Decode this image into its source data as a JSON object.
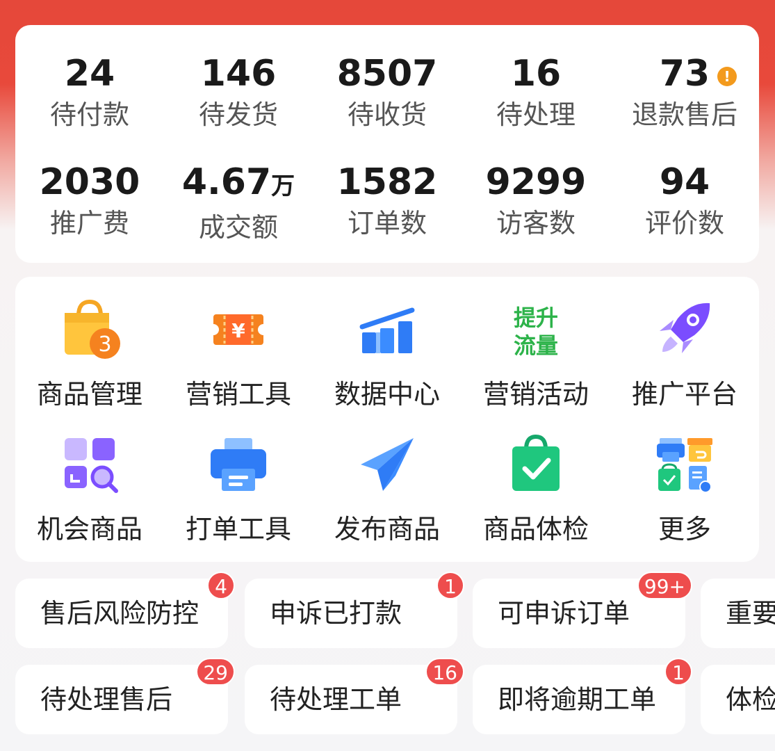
{
  "stats": {
    "row1": [
      {
        "value": "24",
        "label": "待付款"
      },
      {
        "value": "146",
        "label": "待发货"
      },
      {
        "value": "8507",
        "label": "待收货"
      },
      {
        "value": "16",
        "label": "待处理"
      },
      {
        "value": "73",
        "label": "退款售后",
        "alert": "!"
      }
    ],
    "row2": [
      {
        "value": "2030",
        "label": "推广费"
      },
      {
        "value": "4.67",
        "unit": "万",
        "label": "成交额"
      },
      {
        "value": "1582",
        "label": "订单数"
      },
      {
        "value": "9299",
        "label": "访客数"
      },
      {
        "value": "94",
        "label": "评价数"
      }
    ]
  },
  "tools": {
    "row1": [
      {
        "label": "商品管理",
        "icon": "shopping-bag-icon",
        "icon_badge": "3"
      },
      {
        "label": "营销工具",
        "icon": "coupon-icon",
        "icon_text": "¥"
      },
      {
        "label": "数据中心",
        "icon": "bar-chart-icon"
      },
      {
        "label": "营销活动",
        "icon": "boost-traffic-icon",
        "icon_text_1": "提升",
        "icon_text_2": "流量"
      },
      {
        "label": "推广平台",
        "icon": "rocket-icon"
      }
    ],
    "row2": [
      {
        "label": "机会商品",
        "icon": "grid-search-icon"
      },
      {
        "label": "打单工具",
        "icon": "printer-icon"
      },
      {
        "label": "发布商品",
        "icon": "paper-plane-icon"
      },
      {
        "label": "商品体检",
        "icon": "bag-check-icon"
      },
      {
        "label": "更多",
        "icon": "more-apps-icon"
      }
    ]
  },
  "chips": {
    "row1": [
      {
        "label": "售后风险防控",
        "badge": "4"
      },
      {
        "label": "申诉已打款",
        "badge": "1"
      },
      {
        "label": "可申诉订单",
        "badge": "99+"
      },
      {
        "label": "重要"
      }
    ],
    "row2": [
      {
        "label": "待处理售后",
        "badge": "29"
      },
      {
        "label": "待处理工单",
        "badge": "16"
      },
      {
        "label": "即将逾期工单",
        "badge": "1"
      },
      {
        "label": "体检"
      }
    ]
  },
  "colors": {
    "brand_red": "#e5483a",
    "badge_red": "#ee4d4d",
    "alert_orange": "#f39a1d",
    "green_text": "#2db34a"
  }
}
